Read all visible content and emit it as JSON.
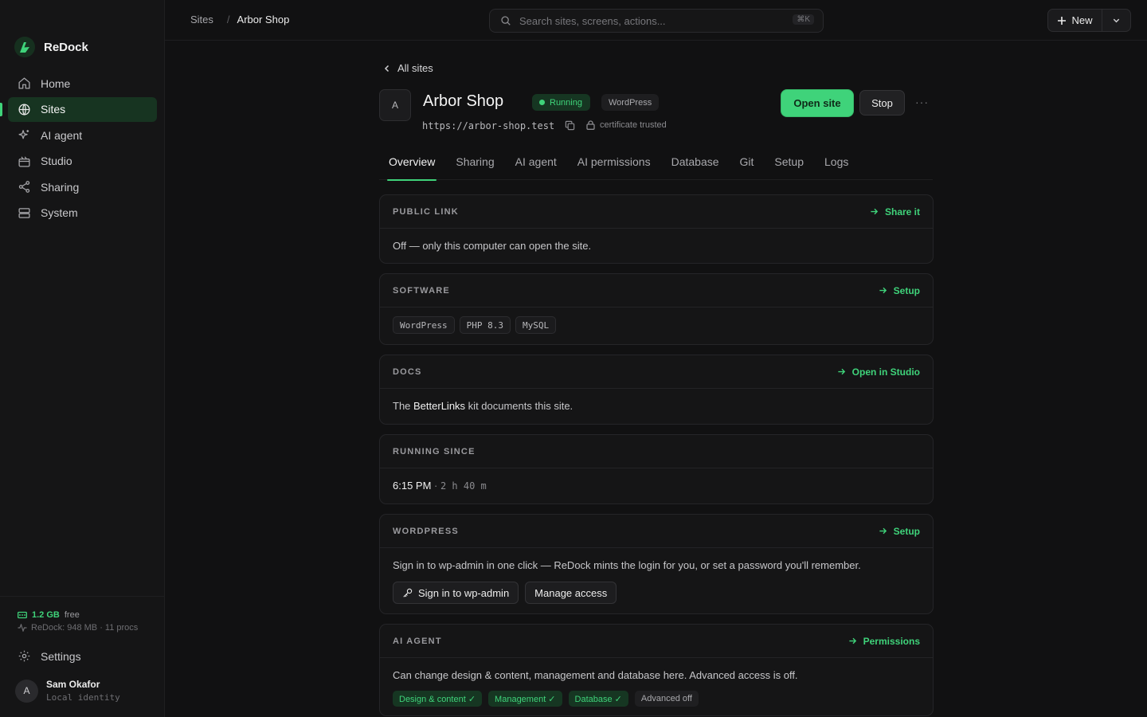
{
  "app": {
    "name": "ReDock"
  },
  "sidebar": {
    "items": [
      {
        "label": "Home",
        "icon": "home-icon"
      },
      {
        "label": "Sites",
        "icon": "globe-icon",
        "active": true
      },
      {
        "label": "AI agent",
        "icon": "sparkle-icon"
      },
      {
        "label": "Studio",
        "icon": "studio-icon"
      },
      {
        "label": "Sharing",
        "icon": "share-icon"
      },
      {
        "label": "System",
        "icon": "server-icon"
      }
    ],
    "memory": {
      "value": "1.2 GB",
      "suffix": "free",
      "usage": "ReDock: 948 MB · 11 procs"
    },
    "settings_label": "Settings",
    "user": {
      "initial": "A",
      "name": "Sam Okafor",
      "subtitle": "Local identity"
    }
  },
  "topbar": {
    "breadcrumb": {
      "root": "Sites",
      "separator": "/",
      "current": "Arbor Shop"
    },
    "search": {
      "placeholder": "Search sites, screens, actions...",
      "shortcut": "⌘K"
    },
    "new_label": "New"
  },
  "site": {
    "back_label": "All sites",
    "initial": "A",
    "name": "Arbor Shop",
    "status": "Running",
    "platform": "WordPress",
    "url": "https://arbor-shop.test",
    "cert": "certificate trusted",
    "open_label": "Open site",
    "stop_label": "Stop",
    "more_label": "···"
  },
  "tabs": [
    "Overview",
    "Sharing",
    "AI agent",
    "AI permissions",
    "Database",
    "Git",
    "Setup",
    "Logs"
  ],
  "cards": {
    "public_link": {
      "title": "PUBLIC LINK",
      "action": "Share it",
      "text": "Off — only this computer can open the site."
    },
    "software": {
      "title": "SOFTWARE",
      "action": "Setup",
      "chips": [
        "WordPress",
        "PHP 8.3",
        "MySQL"
      ]
    },
    "docs": {
      "title": "DOCS",
      "action": "Open in Studio",
      "prefix": "The ",
      "kit": "BetterLinks",
      "suffix": " kit documents this site."
    },
    "running": {
      "title": "RUNNING SINCE",
      "time": "6:15 PM",
      "sep": " · ",
      "duration": "2 h 40 m"
    },
    "wordpress": {
      "title": "WORDPRESS",
      "action": "Setup",
      "text": "Sign in to wp-admin in one click — ReDock mints the login for you, or set a password you'll remember.",
      "signin_label": "Sign in to wp-admin",
      "manage_label": "Manage access"
    },
    "ai_agent": {
      "title": "AI AGENT",
      "action": "Permissions",
      "text": "Can change design & content, management and database here. Advanced access is off.",
      "perms": [
        "Design & content ✓",
        "Management ✓",
        "Database ✓"
      ],
      "perm_off": "Advanced off"
    }
  },
  "colors": {
    "accent": "#3fd37a",
    "background": "#111112",
    "sidebar": "#151516"
  }
}
